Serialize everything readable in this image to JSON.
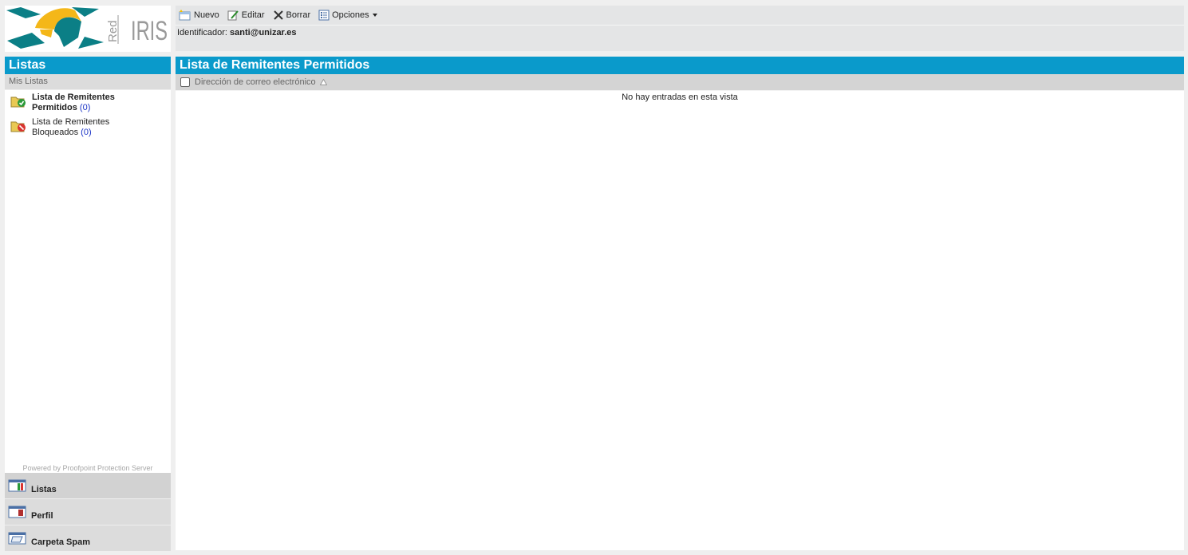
{
  "brand": {
    "logo_text": "IRIS",
    "logo_sub": "Red"
  },
  "toolbar": {
    "new_label": "Nuevo",
    "edit_label": "Editar",
    "delete_label": "Borrar",
    "options_label": "Opciones"
  },
  "identity": {
    "label": "Identificador:",
    "value": "santi@unizar.es"
  },
  "sidebar": {
    "title": "Listas",
    "section": "Mis Listas",
    "items": [
      {
        "label": "Lista de Remitentes Permitidos",
        "count": "(0)",
        "selected": true
      },
      {
        "label": "Lista de Remitentes Bloqueados",
        "count": "(0)",
        "selected": false
      }
    ],
    "powered": "Powered by Proofpoint Protection Server",
    "nav": [
      {
        "label": "Listas"
      },
      {
        "label": "Perfil"
      },
      {
        "label": "Carpeta Spam"
      }
    ]
  },
  "main": {
    "title": "Lista de Remitentes Permitidos",
    "column_email": "Dirección de correo electrónico",
    "empty_message": "No hay entradas en esta vista"
  },
  "colors": {
    "accent": "#0a9acb",
    "logo_teal": "#0b7f86",
    "logo_yellow": "#f4b719"
  }
}
